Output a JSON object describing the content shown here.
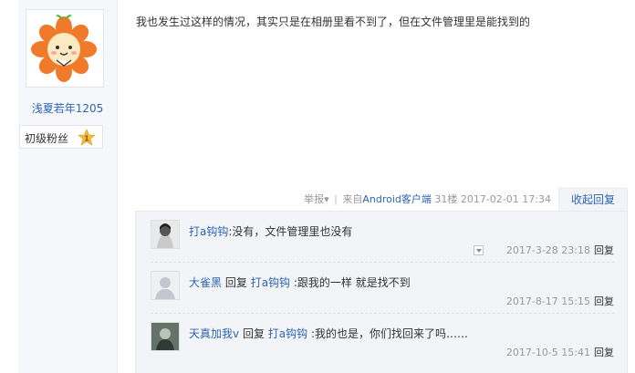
{
  "author": {
    "name": "浅夏若年1205",
    "fan_label": "初级粉丝",
    "fan_level": "1"
  },
  "post": {
    "content": "我也发生过这样的情况，其实只是在相册里看不到了，但在文件管理里是能找到的",
    "report": "举报",
    "report_caret": "▾",
    "separator": "|",
    "client_prefix": "来自",
    "client": "Android客户端",
    "floor": "31楼",
    "time": "2017-02-01 17:34",
    "collapse": "收起回复"
  },
  "replies": [
    {
      "name": "打a钩钩",
      "reply_word": "",
      "target": "",
      "text": ":没有，文件管理里也没有",
      "time": "2017-3-28 23:18",
      "reply_label": "回复"
    },
    {
      "name": "大雀黑",
      "reply_word": "回复",
      "target": "打a钩钩",
      "text": ":跟我的一样 就是找不到",
      "time": "2017-8-17 15:15",
      "reply_label": "回复"
    },
    {
      "name": "天真加我v",
      "reply_word": "回复",
      "target": "打a钩钩",
      "text": ":我的也是，你们找回来了吗……",
      "time": "2017-10-5 15:41",
      "reply_label": "回复"
    }
  ],
  "colors": {
    "link": "#2d64b3",
    "panel_bg": "#f5f7fa",
    "reply_bg": "#f2f4f7",
    "meta_text": "#999999"
  }
}
